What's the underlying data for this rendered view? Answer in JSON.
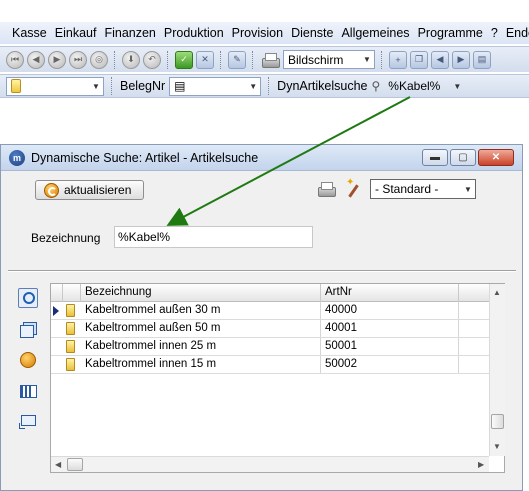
{
  "menu": [
    "Kasse",
    "Einkauf",
    "Finanzen",
    "Produktion",
    "Provision",
    "Dienste",
    "Allgemeines",
    "Programme",
    "?",
    "Ende"
  ],
  "toolbar1": {
    "output_select": "Bildschirm"
  },
  "toolbar2": {
    "beleg_label": "BelegNr",
    "dyn_label": "DynArtikelsuche",
    "search_value": "%Kabel%"
  },
  "dialog": {
    "title": "Dynamische Suche: Artikel - Artikelsuche",
    "refresh_label": "aktualisieren",
    "layout_select": "- Standard -",
    "search_label": "Bezeichnung",
    "search_value": "%Kabel%",
    "columns": [
      "Bezeichnung",
      "ArtNr"
    ],
    "rows": [
      {
        "name": "Kabeltrommel außen 30 m",
        "nr": "40000"
      },
      {
        "name": "Kabeltrommel außen 50 m",
        "nr": "40001"
      },
      {
        "name": "Kabeltrommel innen 25 m",
        "nr": "50001"
      },
      {
        "name": "Kabeltrommel innen 15 m",
        "nr": "50002"
      }
    ]
  },
  "colors": {
    "annotation_arrow": "#1f7a12",
    "titlebar": "#c2d4ec",
    "close_button": "#c94228"
  }
}
